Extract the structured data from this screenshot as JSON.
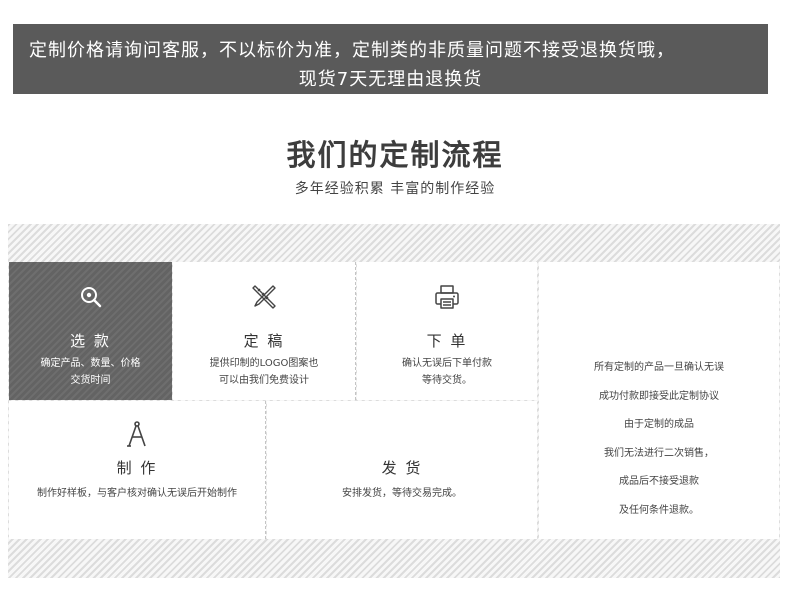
{
  "notice": {
    "line1": "定制价格请询问客服，不以标价为准，定制类的非质量问题不接受退换货哦，",
    "line2": "现货7天无理由退换货"
  },
  "header": {
    "title": "我们的定制流程",
    "subtitle": "多年经验积累 丰富的制作经验"
  },
  "steps": [
    {
      "icon": "search-icon",
      "title": "选 款",
      "desc": [
        "确定产品、数量、价格",
        "交货时间"
      ]
    },
    {
      "icon": "pencil-ruler-icon",
      "title": "定 稿",
      "desc": [
        "提供印制的LOGO图案也",
        "可以由我们免费设计"
      ]
    },
    {
      "icon": "printer-icon",
      "title": "下 单",
      "desc": [
        "确认无误后下单付款",
        "等待交货。"
      ]
    },
    {
      "icon": "compass-icon",
      "title": "制 作",
      "desc": [
        "制作好样板，与客户核对确认无误后开始制作"
      ]
    },
    {
      "icon": "",
      "title": "发 货",
      "desc": [
        "安排发货，等待交易完成。"
      ]
    }
  ],
  "policy": [
    "所有定制的产品一旦确认无误",
    "成功付款即接受此定制协议",
    "由于定制的成品",
    "我们无法进行二次销售，",
    "成品后不接受退款",
    "及任何条件退款。"
  ],
  "colors": {
    "notice_bg": "#5a5a5a",
    "active_step_bg": "#666666",
    "stripe": "#dcdcdc"
  }
}
